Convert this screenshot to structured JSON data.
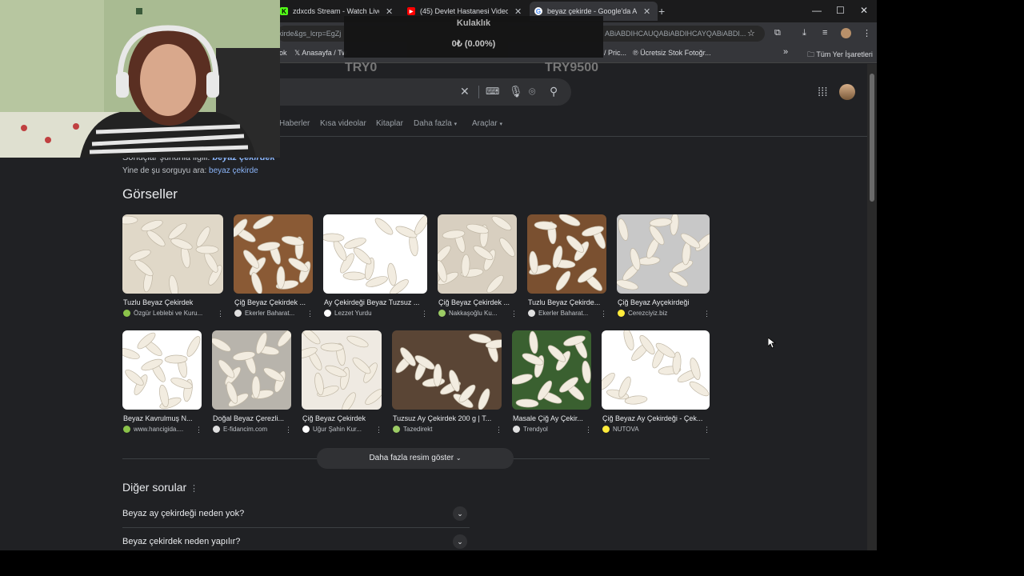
{
  "tabs": [
    {
      "title": "zdxcds Stream - Watch Live on",
      "color": "#53fc18",
      "glyph": "K"
    },
    {
      "title": "(45) Devlet Hastanesi Videoları",
      "color": "#ff0000",
      "glyph": "▶"
    },
    {
      "title": "beyaz çekirde - Google'da Ara",
      "color": "#4285f4",
      "glyph": "G"
    }
  ],
  "omnibox": {
    "url_left": "kirde&gs_lcrp=EgZj",
    "url_right": "ABiABDIHCAUQABiABDIHCAYQABiABDI..."
  },
  "bookmarks": [
    "ok",
    "Anasayfa / Tw",
    "/ Pric...",
    "Ücretsiz Stok Fotoğr...",
    "»",
    "Tüm Yer İşaretleri"
  ],
  "donation": {
    "title": "Kulaklık",
    "amount": "0₺ (0.00%)",
    "min": "TRY0",
    "max": "TRY9500"
  },
  "nav": [
    "Haberler",
    "Kısa videolar",
    "Kitaplar",
    "Daha fazla",
    "Araçlar"
  ],
  "related": {
    "prefix": "Sonuçlar şununla ilgili:",
    "term": "beyaz çekirdek"
  },
  "search_instead": {
    "prefix": "Yine de şu sorguyu ara:",
    "term": "beyaz çekirde"
  },
  "images_title": "Görseller",
  "images_row1": [
    {
      "title": "Tuzlu Beyaz Çekirdek",
      "source": "Özgür Leblebi ve Kuru...",
      "color": "#e0d8c8"
    },
    {
      "title": "Çiğ Beyaz Çekirdek ...",
      "source": "Ekerler Baharat...",
      "color": "#8a5a35"
    },
    {
      "title": "Ay Çekirdeği Beyaz Tuzsuz ...",
      "source": "Lezzet Yurdu",
      "color": "#ffffff"
    },
    {
      "title": "Çiğ Beyaz Çekirdek ...",
      "source": "Nakkaşoğlu Ku...",
      "color": "#d8cfc0"
    },
    {
      "title": "Tuzlu Beyaz Çekirde...",
      "source": "Ekerler Baharat...",
      "color": "#7a5030"
    },
    {
      "title": "Çiğ Beyaz Ayçekirdeği",
      "source": "Cerezciyiz.biz",
      "color": "#c8c8c8"
    }
  ],
  "images_row2": [
    {
      "title": "Beyaz Kavrulmuş N...",
      "source": "www.hancigida....",
      "color": "#ffffff"
    },
    {
      "title": "Doğal Beyaz Çerezli...",
      "source": "E-fidancim.com",
      "color": "#b8b4ac"
    },
    {
      "title": "Çiğ Beyaz Çekirdek",
      "source": "Uğur Şahin Kur...",
      "color": "#efeae2"
    },
    {
      "title": "Tuzsuz Ay Çekirdek 200 g | T...",
      "source": "Tazedirekt",
      "color": "#5a4535"
    },
    {
      "title": "Masale Çiğ Ay Çekir...",
      "source": "Trendyol",
      "color": "#3a6030"
    },
    {
      "title": "Çiğ Beyaz Ay Çekirdeği - Çek...",
      "source": "NUTOVA",
      "color": "#ffffff"
    }
  ],
  "more_images": "Daha fazla resim göster",
  "other_questions": "Diğer sorular",
  "questions": [
    "Beyaz ay çekirdeği neden yok?",
    "Beyaz çekirdek neden yapılır?"
  ]
}
